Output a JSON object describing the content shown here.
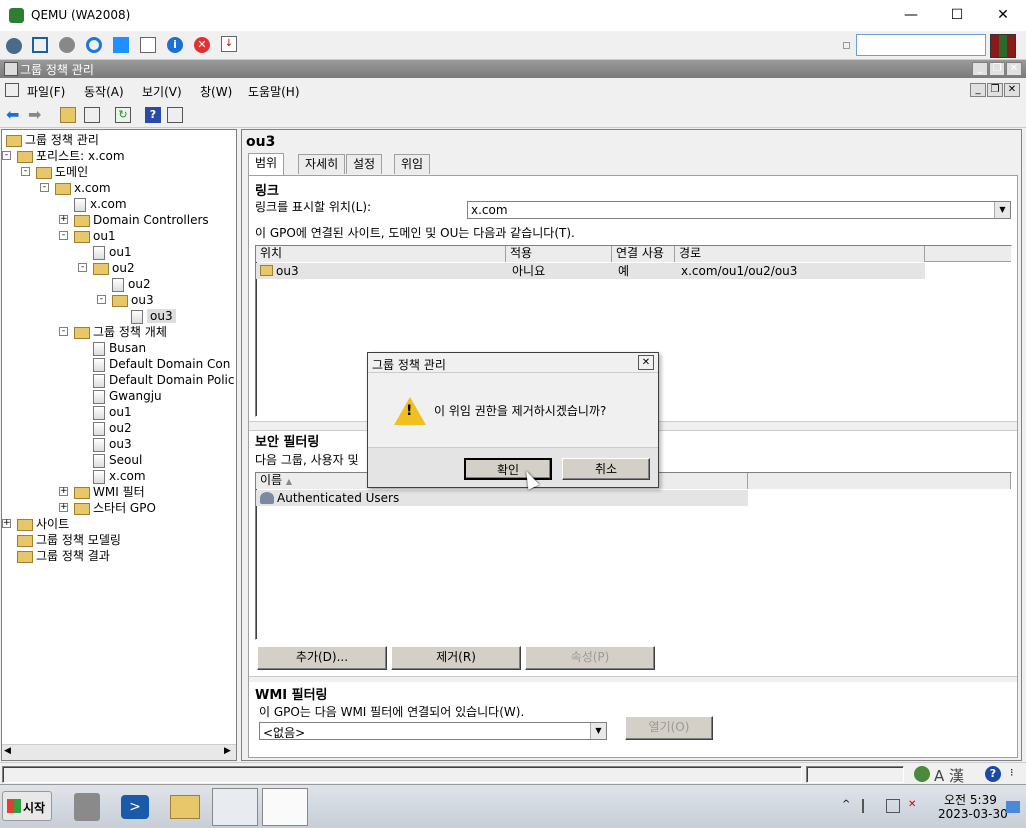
{
  "titlebar": {
    "title": "QEMU (WA2008)"
  },
  "mmc": {
    "title": "그룹 정책 관리"
  },
  "menu": [
    "파일(F)",
    "동작(A)",
    "보기(V)",
    "창(W)",
    "도움말(H)"
  ],
  "tree": [
    {
      "label": "그룹 정책 관리",
      "level": 0,
      "exp": ""
    },
    {
      "label": "포리스트: x.com",
      "level": 1,
      "exp": "−"
    },
    {
      "label": "도메인",
      "level": 2,
      "exp": "−"
    },
    {
      "label": "x.com",
      "level": 3,
      "exp": "−"
    },
    {
      "label": "x.com",
      "level": 4,
      "exp": ""
    },
    {
      "label": "Domain Controllers",
      "level": 4,
      "exp": "+"
    },
    {
      "label": "ou1",
      "level": 4,
      "exp": "−"
    },
    {
      "label": "ou1",
      "level": 5,
      "exp": ""
    },
    {
      "label": "ou2",
      "level": 5,
      "exp": "−"
    },
    {
      "label": "ou2",
      "level": 6,
      "exp": ""
    },
    {
      "label": "ou3",
      "level": 6,
      "exp": "−"
    },
    {
      "label": "ou3",
      "level": 7,
      "exp": "",
      "selected": true
    },
    {
      "label": "그룹 정책 개체",
      "level": 4,
      "exp": "−"
    },
    {
      "label": "Busan",
      "level": 5,
      "exp": ""
    },
    {
      "label": "Default Domain Con",
      "level": 5,
      "exp": ""
    },
    {
      "label": "Default Domain Polic",
      "level": 5,
      "exp": ""
    },
    {
      "label": "Gwangju",
      "level": 5,
      "exp": ""
    },
    {
      "label": "ou1",
      "level": 5,
      "exp": ""
    },
    {
      "label": "ou2",
      "level": 5,
      "exp": ""
    },
    {
      "label": "ou3",
      "level": 5,
      "exp": ""
    },
    {
      "label": "Seoul",
      "level": 5,
      "exp": ""
    },
    {
      "label": "x.com",
      "level": 5,
      "exp": ""
    },
    {
      "label": "WMI 필터",
      "level": 4,
      "exp": "+"
    },
    {
      "label": "스타터 GPO",
      "level": 4,
      "exp": "+"
    },
    {
      "label": "사이트",
      "level": 1,
      "exp": "+"
    },
    {
      "label": "그룹 정책 모델링",
      "level": 1,
      "exp": ""
    },
    {
      "label": "그룹 정책 결과",
      "level": 1,
      "exp": ""
    }
  ],
  "detail": {
    "title": "ou3",
    "tabs": [
      "범위",
      "자세히",
      "설정",
      "위임"
    ],
    "links_heading": "링크",
    "links_location_label": "링크를 표시할 위치(L):",
    "links_location_value": "x.com",
    "links_desc": "이 GPO에 연결된 사이트, 도메인 및 OU는 다음과 같습니다(T).",
    "links_columns": [
      "위치",
      "적용",
      "연결 사용",
      "경로"
    ],
    "links_rows": [
      {
        "loc": "ou3",
        "enforced": "아니요",
        "enabled": "예",
        "path": "x.com/ou1/ou2/ou3"
      }
    ],
    "sec_heading": "보안 필터링",
    "sec_desc": "다음 그룹, 사용자 및",
    "sec_column": "이름",
    "sec_rows": [
      "Authenticated Users"
    ],
    "btn_add": "추가(D)...",
    "btn_remove": "제거(R)",
    "btn_props": "속성(P)",
    "wmi_heading": "WMI 필터링",
    "wmi_desc": "이 GPO는 다음 WMI 필터에 연결되어 있습니다(W).",
    "wmi_value": "<없음>",
    "wmi_open": "열기(O)"
  },
  "dialog": {
    "title": "그룹 정책 관리",
    "message": "이 위임 권한을 제거하시겠습니까?",
    "ok": "확인",
    "cancel": "취소"
  },
  "taskbar": {
    "start": "시작",
    "time": "오전 5:39",
    "date": "2023-03-30",
    "ime": "A 漢"
  }
}
